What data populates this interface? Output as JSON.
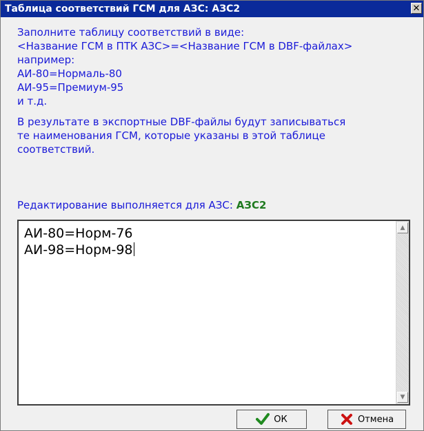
{
  "window": {
    "title": "Таблица соответствий ГСМ для АЗС: АЗС2",
    "close_glyph": "✕"
  },
  "instructions": {
    "lines": [
      "Заполните таблицу соответствий в виде:",
      "<Название ГСМ в ПТК АЗС>=<Название ГСМ в DBF-файлах>",
      "например:",
      "АИ-80=Нормаль-80",
      "АИ-95=Премиум-95",
      "и т.д."
    ],
    "result_lines": [
      "В результате в экспортные DBF-файлы будут записываться",
      "те наименования ГСМ, которые указаны в этой таблице",
      "соответствий."
    ],
    "editing_for_label": "Редактирование выполняется для АЗС:",
    "station": "АЗС2"
  },
  "editor": {
    "lines": [
      "АИ-80=Норм-76",
      "АИ-98=Норм-98"
    ]
  },
  "buttons": {
    "ok_label": "ОК",
    "cancel_label": "Отмена"
  },
  "colors": {
    "titlebar": "#0a2a9a",
    "instruction_text": "#1a1ad8",
    "station_text": "#1f7a1f",
    "ok_icon": "#1f8a1f",
    "cancel_icon": "#cc1111"
  },
  "icons": {
    "ok": "checkmark-icon",
    "cancel": "x-icon",
    "scroll_up": "scroll-up-arrow-icon",
    "scroll_down": "scroll-down-arrow-icon"
  }
}
